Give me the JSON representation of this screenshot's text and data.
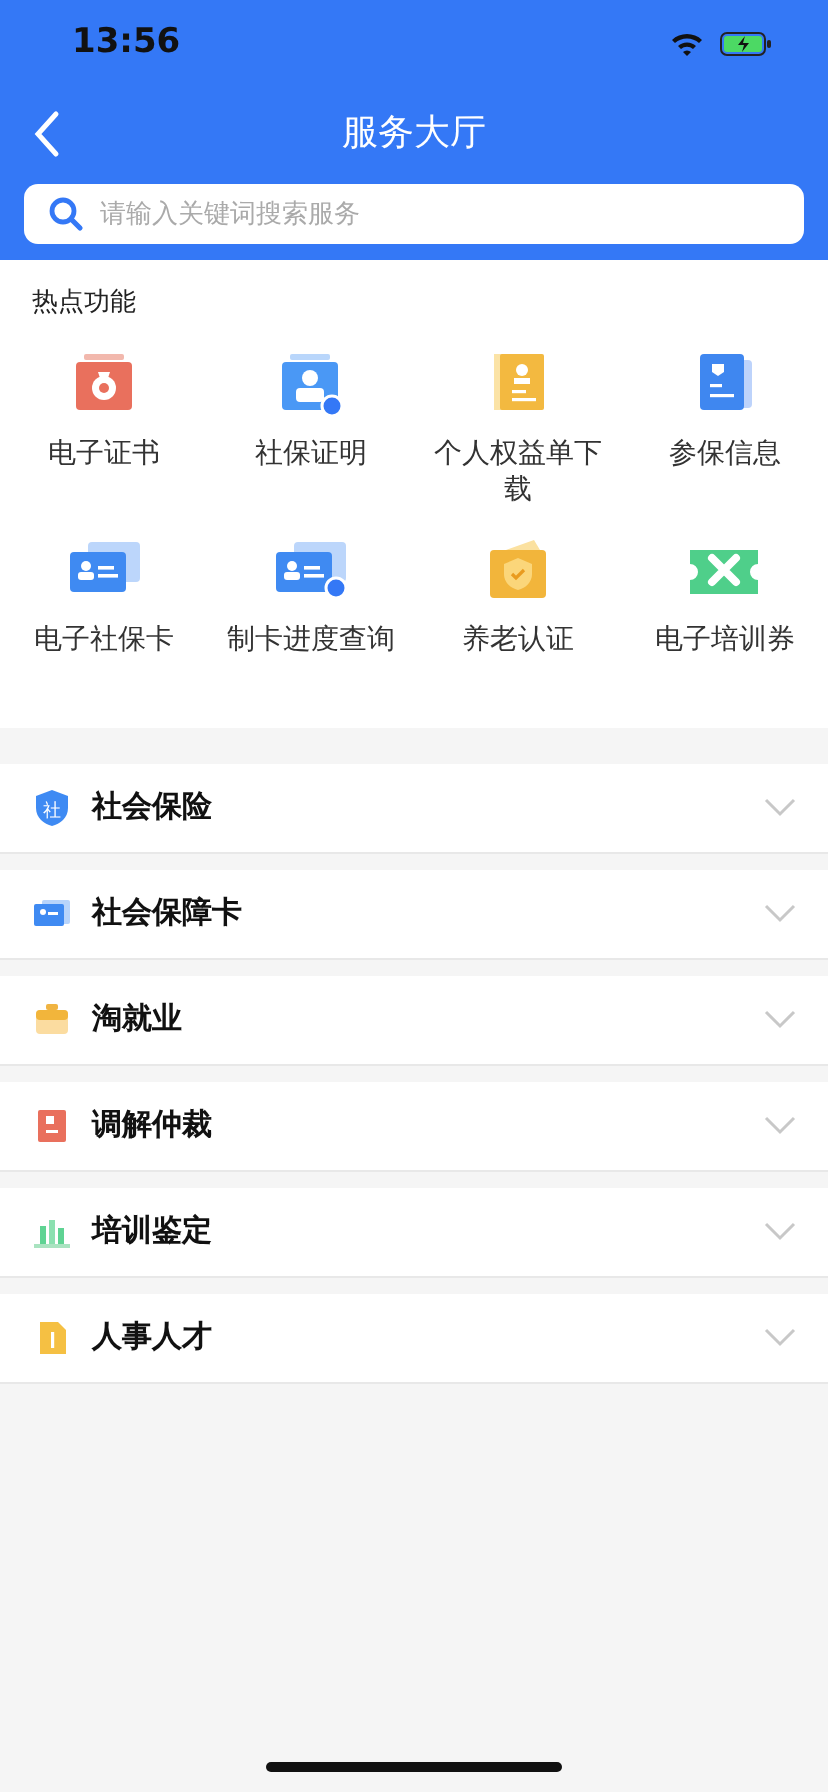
{
  "status_bar": {
    "time": "13:56"
  },
  "nav": {
    "title": "服务大厅"
  },
  "search": {
    "placeholder": "请输入关键词搜索服务"
  },
  "hot": {
    "title": "热点功能",
    "items": [
      {
        "label": "电子证书",
        "kind": "medal"
      },
      {
        "label": "社保证明",
        "kind": "person"
      },
      {
        "label": "个人权益单下载",
        "kind": "docyellow"
      },
      {
        "label": "参保信息",
        "kind": "docblue"
      },
      {
        "label": "电子社保卡",
        "kind": "card"
      },
      {
        "label": "制卡进度查询",
        "kind": "cardbadge"
      },
      {
        "label": "养老认证",
        "kind": "shield"
      },
      {
        "label": "电子培训券",
        "kind": "ticket"
      }
    ]
  },
  "sections": [
    {
      "label": "社会保险",
      "kind": "shield",
      "icon_text": "社",
      "expanded": false
    },
    {
      "label": "社会保障卡",
      "kind": "card",
      "expanded": false
    },
    {
      "label": "淘就业",
      "kind": "briefcase",
      "expanded": false
    },
    {
      "label": "调解仲裁",
      "kind": "reddoc",
      "expanded": false
    },
    {
      "label": "培训鉴定",
      "kind": "bars",
      "expanded": false
    },
    {
      "label": "人事人才",
      "kind": "yellowdoc",
      "expanded": false
    }
  ]
}
